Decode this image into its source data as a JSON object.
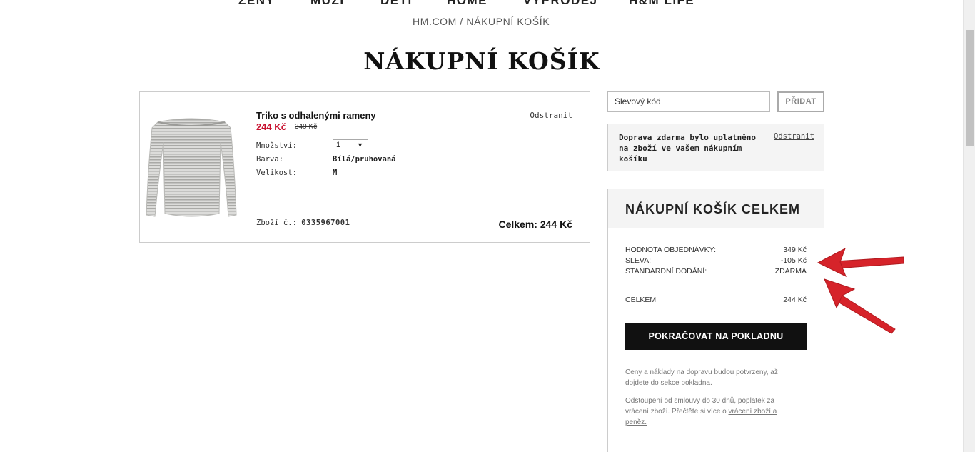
{
  "nav": {
    "items": [
      "ŽENY",
      "MUŽI",
      "DĚTI",
      "HOME",
      "VÝPRODEJ",
      "H&M LIFE"
    ]
  },
  "breadcrumb": {
    "home": "HM.COM",
    "separator": " / ",
    "current": "NÁKUPNÍ KOŠÍK"
  },
  "page_title": "NÁKUPNÍ KOŠÍK",
  "cart_item": {
    "name": "Triko s odhalenými rameny",
    "price": "244 Kč",
    "old_price": "349 Kč",
    "remove_label": "Odstranit",
    "quantity_label": "Množství:",
    "quantity_value": "1",
    "color_label": "Barva:",
    "color_value": "Bílá/pruhovaná",
    "size_label": "Velikost:",
    "size_value": "M",
    "sku_label": "Zboží č.:",
    "sku_value": "0335967001",
    "total": "Celkem: 244 Kč"
  },
  "coupon": {
    "placeholder": "Slevový kód",
    "button_label": "PŘIDAT"
  },
  "promo": {
    "text": "Doprava zdarma bylo uplatněno na zboží ve vašem nákupním košíku",
    "remove_label": "Odstranit"
  },
  "summary": {
    "title": "NÁKUPNÍ KOŠÍK CELKEM",
    "order_value_label": "HODNOTA OBJEDNÁVKY:",
    "order_value": "349 Kč",
    "discount_label": "SLEVA:",
    "discount_value": "-105 Kč",
    "shipping_label": "STANDARDNÍ DODÁNÍ:",
    "shipping_value": "ZDARMA",
    "total_label": "CELKEM",
    "total_value": "244 Kč",
    "checkout_label": "POKRAČOVAT NA POKLADNU",
    "note1": "Ceny a náklady na dopravu budou potvrzeny, až dojdete do sekce pokladna.",
    "note2_text": "Odstoupení od smlouvy do 30 dnů, poplatek za vrácení zboží. Přečtěte si více o ",
    "note2_link": "vrácení zboží a peněz."
  },
  "colors": {
    "sale_red": "#c8102e",
    "arrow_red": "#d6232a",
    "checkout_black": "#111111"
  }
}
